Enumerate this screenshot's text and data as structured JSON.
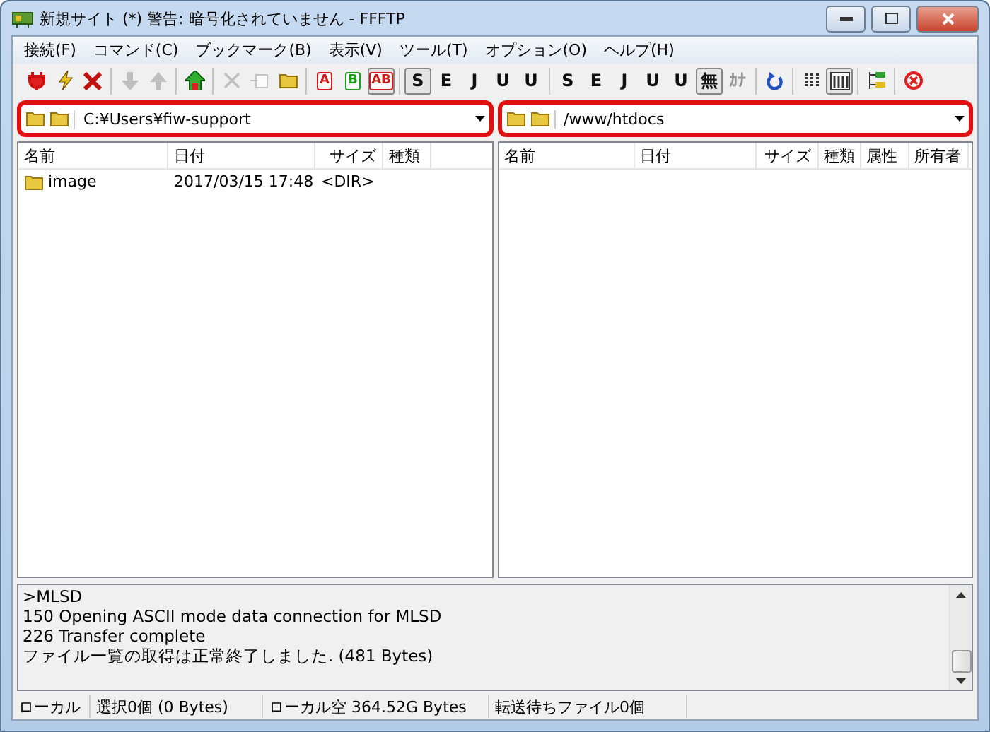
{
  "window": {
    "title": "新規サイト (*) 警告: 暗号化されていません - FFFTP"
  },
  "menu": [
    "接続(F)",
    "コマンド(C)",
    "ブックマーク(B)",
    "表示(V)",
    "ツール(T)",
    "オプション(O)",
    "ヘルプ(H)"
  ],
  "toolbar": [
    [
      {
        "kind": "plug",
        "pressed": false,
        "disabled": false
      },
      {
        "kind": "bolt",
        "pressed": false,
        "disabled": false
      },
      {
        "kind": "cross",
        "pressed": false,
        "disabled": false
      }
    ],
    [
      {
        "kind": "down",
        "pressed": false,
        "disabled": true
      },
      {
        "kind": "up",
        "pressed": false,
        "disabled": true
      }
    ],
    [
      {
        "kind": "house",
        "pressed": false,
        "disabled": false
      }
    ],
    [
      {
        "kind": "delete",
        "pressed": false,
        "disabled": true
      },
      {
        "kind": "rename",
        "pressed": false,
        "disabled": true
      },
      {
        "kind": "folder",
        "pressed": false,
        "disabled": false
      }
    ],
    [
      {
        "kind": "boxed",
        "label": "A",
        "color": "#d01818",
        "pressed": false,
        "disabled": false
      },
      {
        "kind": "boxed",
        "label": "B",
        "color": "#18a018",
        "pressed": false,
        "disabled": false
      },
      {
        "kind": "boxed",
        "label": "AB",
        "color": "#d01818",
        "pressed": true,
        "disabled": false
      }
    ],
    [
      {
        "kind": "letter",
        "label": "S",
        "pressed": true,
        "disabled": false
      },
      {
        "kind": "letter",
        "label": "E",
        "pressed": false,
        "disabled": false
      },
      {
        "kind": "letter",
        "label": "J",
        "pressed": false,
        "disabled": false
      },
      {
        "kind": "letter",
        "label": "U",
        "pressed": false,
        "disabled": false
      },
      {
        "kind": "letter",
        "label": "U",
        "pressed": false,
        "disabled": false
      }
    ],
    [
      {
        "kind": "letter",
        "label": "S",
        "pressed": false,
        "disabled": false
      },
      {
        "kind": "letter",
        "label": "E",
        "pressed": false,
        "disabled": false
      },
      {
        "kind": "letter",
        "label": "J",
        "pressed": false,
        "disabled": false
      },
      {
        "kind": "letter",
        "label": "U",
        "pressed": false,
        "disabled": false
      },
      {
        "kind": "letter",
        "label": "U",
        "pressed": false,
        "disabled": false
      },
      {
        "kind": "letter",
        "label": "無",
        "pressed": true,
        "disabled": false
      },
      {
        "kind": "letter",
        "label": "ｶﾅ",
        "pressed": false,
        "disabled": true
      }
    ],
    [
      {
        "kind": "refresh",
        "pressed": false,
        "disabled": false
      }
    ],
    [
      {
        "kind": "list",
        "pressed": false,
        "disabled": false
      },
      {
        "kind": "details",
        "pressed": true,
        "disabled": false
      }
    ],
    [
      {
        "kind": "sync",
        "pressed": false,
        "disabled": false
      }
    ],
    [
      {
        "kind": "stop",
        "pressed": false,
        "disabled": false
      }
    ]
  ],
  "local": {
    "path": "C:¥Users¥fiw-support",
    "columns": [
      "名前",
      "日付",
      "サイズ",
      "種類"
    ],
    "rows": [
      {
        "name": "image",
        "date": "2017/03/15 17:48",
        "size": "<DIR>"
      }
    ]
  },
  "remote": {
    "path": "/www/htdocs",
    "columns": [
      "名前",
      "日付",
      "サイズ",
      "種類",
      "属性",
      "所有者"
    ]
  },
  "log": [
    ">MLSD",
    "150 Opening ASCII mode data connection for MLSD",
    "226 Transfer complete",
    "ファイル一覧の取得は正常終了しました. (481 Bytes)"
  ],
  "status_bar": [
    "ローカル",
    "選択0個 (0 Bytes)",
    "ローカル空 364.52G Bytes",
    "転送待ちファイル0個"
  ]
}
